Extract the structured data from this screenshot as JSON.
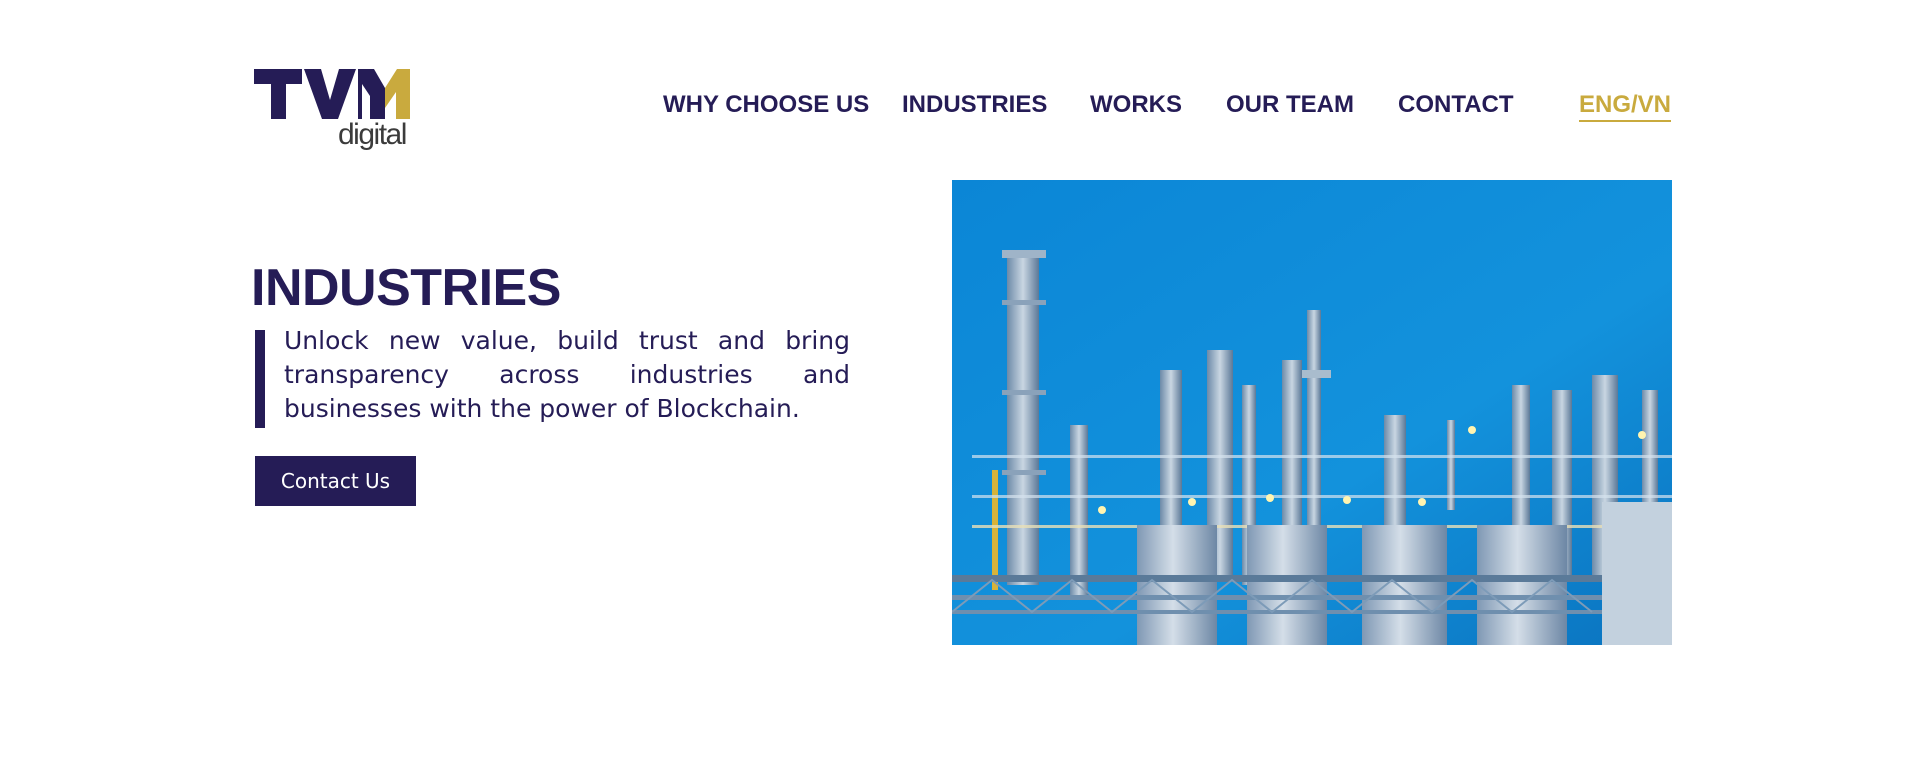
{
  "brand": {
    "logo_word": "TVM",
    "logo_sub": "digital"
  },
  "nav": {
    "items": [
      {
        "label": "WHY CHOOSE US"
      },
      {
        "label": "INDUSTRIES"
      },
      {
        "label": "WORKS"
      },
      {
        "label": "OUR TEAM"
      },
      {
        "label": "CONTACT"
      }
    ],
    "language": "ENG/VN"
  },
  "hero": {
    "title": "INDUSTRIES",
    "text": "Unlock new value, build trust and bring transparency across industries and businesses with the power of Blockchain.",
    "cta_label": "Contact Us",
    "image_alt": "Industrial refinery at dusk"
  },
  "colors": {
    "primary": "#251c56",
    "gold": "#c9aa3e",
    "sky": "#1a8fd8"
  }
}
